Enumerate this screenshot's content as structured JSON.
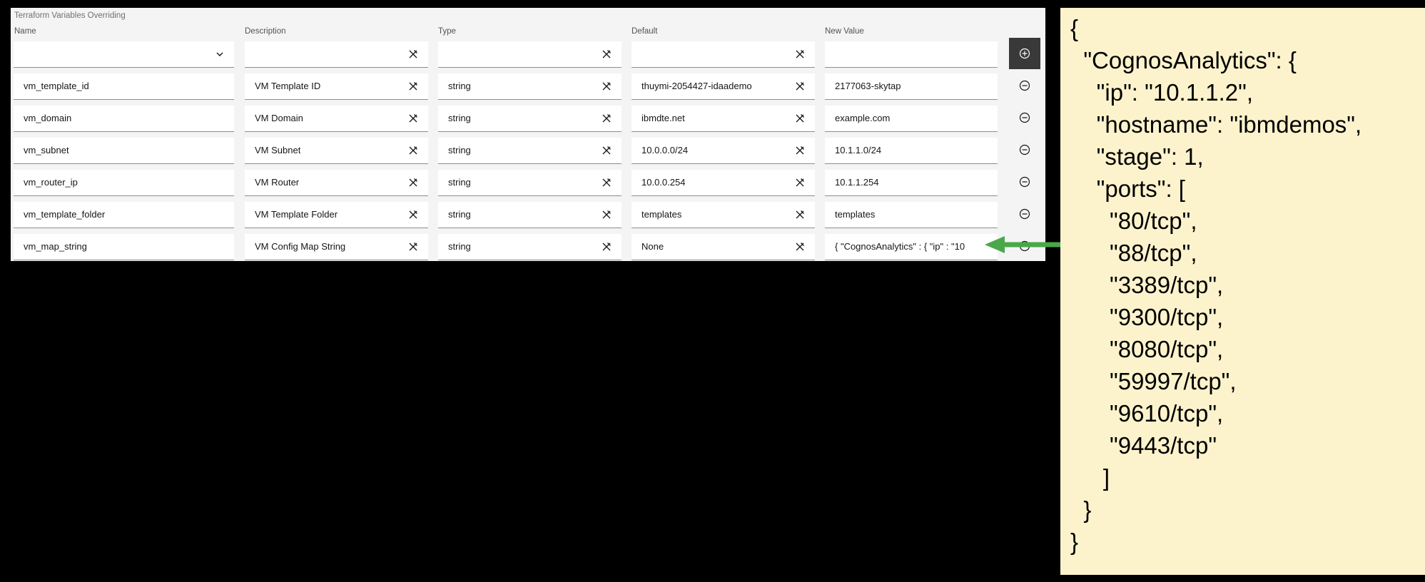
{
  "panel": {
    "title": "Terraform Variables Overriding",
    "columns": {
      "name": "Name",
      "description": "Description",
      "type": "Type",
      "default": "Default",
      "new_value": "New Value"
    }
  },
  "rows": [
    {
      "name": "vm_template_id",
      "description": "VM Template ID",
      "type": "string",
      "default": "thuymi-2054427-idaademo",
      "new_value": "2177063-skytap"
    },
    {
      "name": "vm_domain",
      "description": "VM Domain",
      "type": "string",
      "default": "ibmdte.net",
      "new_value": "example.com"
    },
    {
      "name": "vm_subnet",
      "description": "VM Subnet",
      "type": "string",
      "default": "10.0.0.0/24",
      "new_value": "10.1.1.0/24"
    },
    {
      "name": "vm_router_ip",
      "description": "VM Router",
      "type": "string",
      "default": "10.0.0.254",
      "new_value": "10.1.1.254"
    },
    {
      "name": "vm_template_folder",
      "description": "VM Template Folder",
      "type": "string",
      "default": "templates",
      "new_value": "templates"
    },
    {
      "name": "vm_map_string",
      "description": "VM Config Map String",
      "type": "string",
      "default": "None",
      "new_value": "{   \"CognosAnalytics\" : { \"ip\" : \"10"
    }
  ],
  "json_note": {
    "lines": [
      "{",
      "  \"CognosAnalytics\": {",
      "    \"ip\": \"10.1.1.2\",",
      "    \"hostname\": \"ibmdemos\",",
      "    \"stage\": 1,",
      "    \"ports\": [",
      "      \"80/tcp\",",
      "      \"88/tcp\",",
      "      \"3389/tcp\",",
      "      \"9300/tcp\",",
      "      \"8080/tcp\",",
      "      \"59997/tcp\",",
      "      \"9610/tcp\",",
      "      \"9443/tcp\"",
      "     ]",
      "  }",
      "}"
    ]
  },
  "colors": {
    "arrow": "#4aa84a",
    "note_background": "#fcf3cc",
    "add_button": "#393939"
  },
  "icons": {
    "add": "add-circle-icon",
    "remove": "subtract-circle-icon",
    "clear": "clear-icon",
    "dropdown": "chevron-down-icon"
  }
}
